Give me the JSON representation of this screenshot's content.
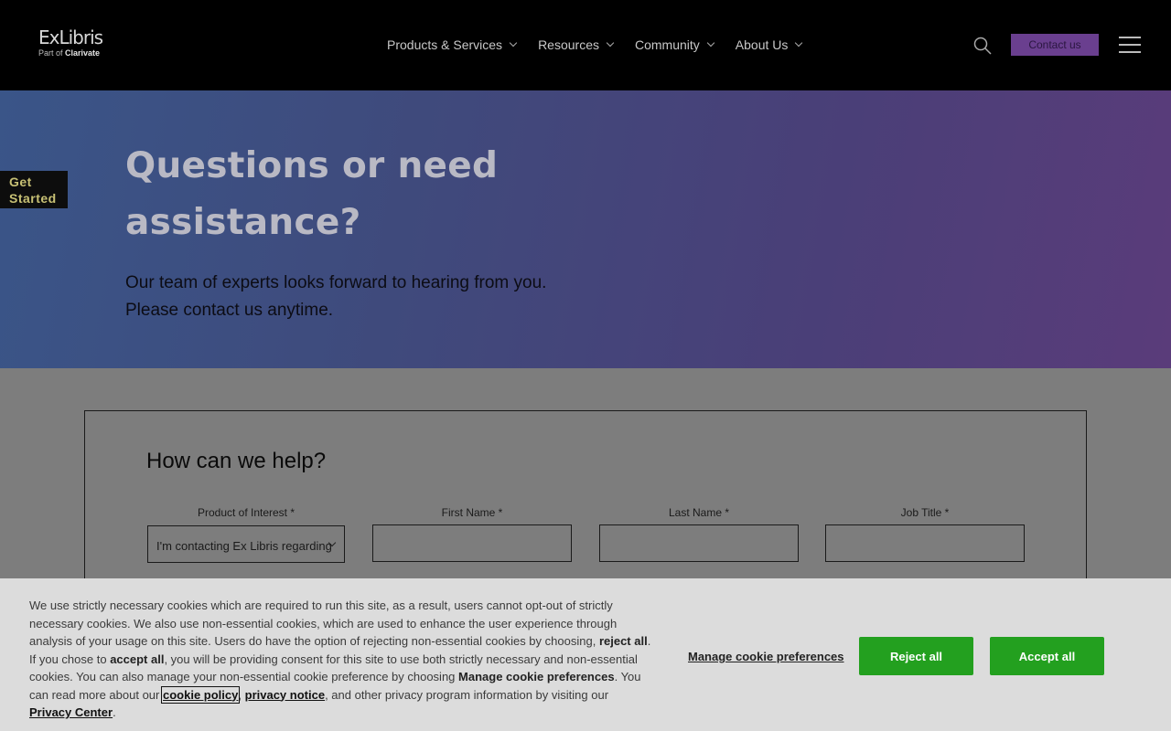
{
  "header": {
    "logo_main": "ExLibris",
    "logo_part_of": "Part of",
    "logo_brand": "Clarivate",
    "nav": [
      {
        "label": "Products & Services"
      },
      {
        "label": "Resources"
      },
      {
        "label": "Community"
      },
      {
        "label": "About Us"
      }
    ],
    "contact_label": "Contact us",
    "accent": "#6a3f8f"
  },
  "hero": {
    "title": "Questions or need assistance?",
    "subtitle_line1": "Our team of experts looks forward to hearing from you.",
    "subtitle_line2": "Please contact us anytime."
  },
  "sidebar_tab": {
    "line1": "Get",
    "line2": "Started"
  },
  "form": {
    "title": "How can we help?",
    "fields": [
      {
        "label": "Product of Interest *",
        "value": "I'm contacting Ex Libris regarding"
      },
      {
        "label": "First Name *",
        "value": ""
      },
      {
        "label": "Last Name *",
        "value": ""
      },
      {
        "label": "Job Title *",
        "value": ""
      }
    ]
  },
  "cookie": {
    "text_1": "We use strictly necessary cookies which are required to run this site, as a result, users cannot opt-out of strictly necessary cookies. We also use non-essential cookies, which are used to enhance the user experience through analysis of your usage on this site. Users do have the option of rejecting non-essential cookies by choosing,",
    "reject_all_inline": "reject all",
    "text_2": ". If you chose to",
    "accept_all_inline": "accept all",
    "text_3": ", you will be providing consent for this site to use both strictly necessary and non-essential cookies. You can also manage your non-essential cookie preference by choosing",
    "manage_inline": "Manage cookie preferences",
    "text_4": ". You can read more about our",
    "cookie_policy": "cookie policy",
    "text_5": ",",
    "privacy_notice": "privacy notice",
    "text_6": ", and other privacy program information by visiting our",
    "privacy_center": "Privacy Center",
    "text_7": ".",
    "manage_link": "Manage cookie preferences",
    "reject_button": "Reject all",
    "accept_button": "Accept all",
    "button_color": "#23a01f"
  }
}
